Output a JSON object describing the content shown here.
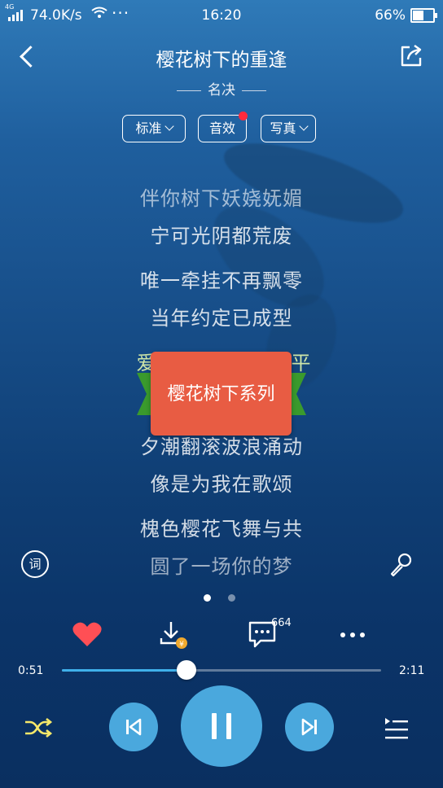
{
  "status_bar": {
    "network_type": "4G",
    "speed": "74.0K/s",
    "more": "···",
    "time": "16:20",
    "battery": "66%",
    "battery_level": 0.66
  },
  "header": {
    "title": "樱花树下的重逢",
    "artist": "名决"
  },
  "pills": [
    {
      "label": "标准",
      "has_chevron": true
    },
    {
      "label": "音效",
      "has_chevron": false,
      "has_red_dot": true
    },
    {
      "label": "写真",
      "has_chevron": true
    }
  ],
  "lyrics": [
    "伴你树下妖娆妩媚",
    "宁可光阴都荒废",
    "唯一牵挂不再飘零",
    "当年约定已成型",
    "爱",
    "平",
    "夕潮翻滚波浪涌动",
    "像是为我在歌颂",
    "槐色樱花飞舞与共",
    "圆了一场你的梦"
  ],
  "overlay_badge": "樱花树下系列",
  "lyrics_toggle_label": "词",
  "pager": {
    "count": 2,
    "active": 0
  },
  "actions": {
    "comment_count": "664"
  },
  "progress": {
    "current": "0:51",
    "total": "2:11",
    "fraction": 0.39
  },
  "colors": {
    "accent": "#3fb0ea",
    "control": "#4aa8dd",
    "heart": "#ff4f55",
    "badge": "#e85c43",
    "shuffle": "#f6e86a"
  },
  "icons": {
    "back": "chevron-left-icon",
    "share": "share-icon",
    "lyrics": "lyrics-icon",
    "mic": "microphone-icon",
    "favorite": "heart-icon",
    "download": "download-icon",
    "comment": "comment-icon",
    "more": "more-icon",
    "shuffle": "shuffle-icon",
    "prev": "previous-icon",
    "pause": "pause-icon",
    "next": "next-icon",
    "playlist": "playlist-icon"
  }
}
